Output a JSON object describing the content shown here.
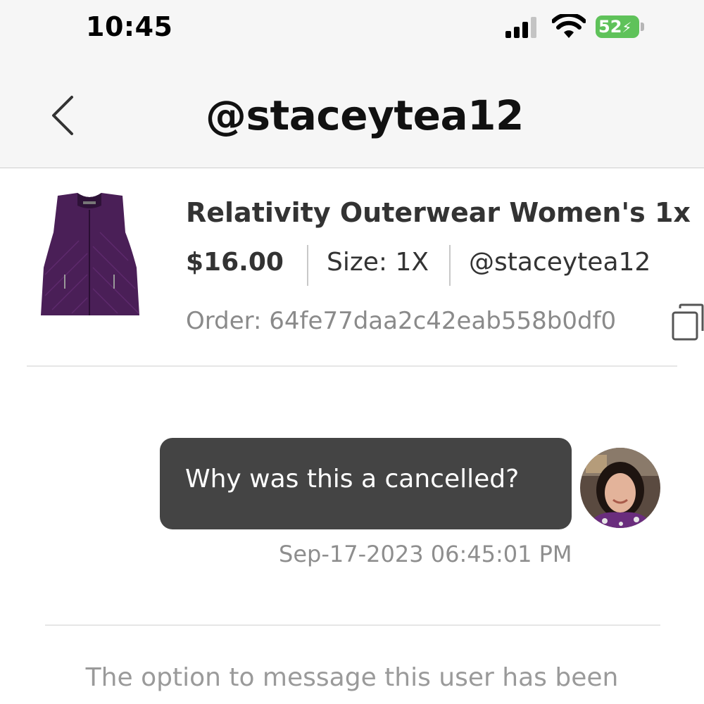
{
  "status_bar": {
    "time": "10:45",
    "battery_level": "52",
    "icons": [
      "signal-icon",
      "wifi-icon",
      "battery-icon"
    ]
  },
  "header": {
    "title": "@staceytea12",
    "back_icon": "chevron-left-icon"
  },
  "product": {
    "title": "Relativity Outerwear Women's 1x",
    "price": "$16.00",
    "size": "Size: 1X",
    "seller": "@staceytea12",
    "order": "Order: 64fe77daa2c42eab558b0df0",
    "image": "purple-quilted-vest"
  },
  "messages": [
    {
      "text": "Why was this a cancelled?",
      "timestamp": "Sep-17-2023 06:45:01 PM",
      "avatar": "user-avatar"
    }
  ],
  "notice": "The option to message this user has been",
  "colors": {
    "bubble": "#444444",
    "battery": "#5fc25a",
    "muted_text": "#8a8a8a",
    "nav_background": "#f6f6f6"
  }
}
